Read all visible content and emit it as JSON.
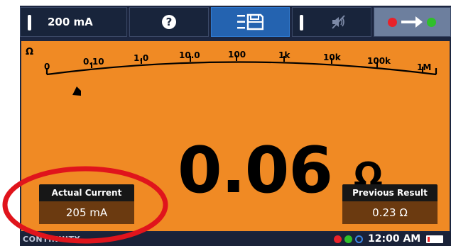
{
  "toolbar": {
    "range_label": "200 mA",
    "help_glyph": "?",
    "colors": {
      "bar": "#18243b",
      "active": "#2463b0",
      "inactive": "#6d7f9e"
    }
  },
  "scale": {
    "unit_symbol": "Ω",
    "tick_labels": [
      "0",
      "0.10",
      "1.0",
      "10.0",
      "100",
      "1k",
      "10k",
      "100k",
      "1M"
    ]
  },
  "reading": {
    "value": "0.06",
    "unit": "Ω"
  },
  "actual_current": {
    "title": "Actual Current",
    "value": "205 mA"
  },
  "previous_result": {
    "title": "Previous Result",
    "value": "0.23 Ω"
  },
  "status_bar": {
    "mode": "CONTINUITY",
    "time": "12:00 AM"
  },
  "colors": {
    "panel": "#f08a24",
    "dark_navy": "#1c2640",
    "annotation": "#e0141c"
  }
}
